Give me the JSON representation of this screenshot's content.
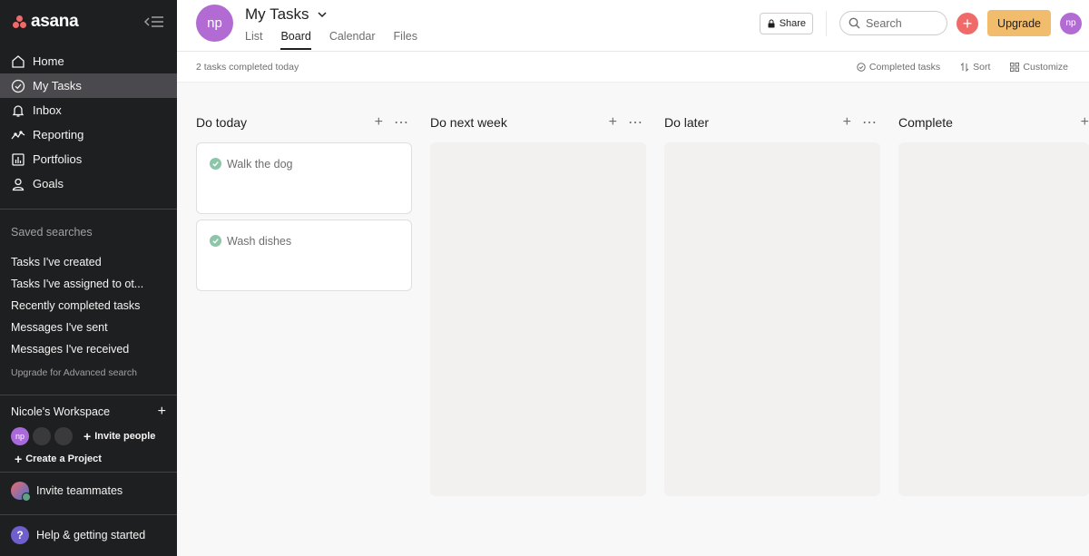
{
  "sidebar": {
    "logo_text": "asana",
    "nav": [
      {
        "label": "Home",
        "icon": "home-icon"
      },
      {
        "label": "My Tasks",
        "icon": "check-circle-icon",
        "active": true
      },
      {
        "label": "Inbox",
        "icon": "bell-icon"
      },
      {
        "label": "Reporting",
        "icon": "chart-line-icon"
      },
      {
        "label": "Portfolios",
        "icon": "bar-chart-icon"
      },
      {
        "label": "Goals",
        "icon": "person-icon"
      }
    ],
    "saved_searches_title": "Saved searches",
    "saved_searches": [
      "Tasks I've created",
      "Tasks I've assigned to ot...",
      "Recently completed tasks",
      "Messages I've sent",
      "Messages I've received"
    ],
    "upgrade_search": "Upgrade for Advanced search",
    "workspace_name": "Nicole's Workspace",
    "workspace_avatar": "np",
    "invite_people": "Invite people",
    "create_project": "Create a Project",
    "invite_teammates": "Invite teammates",
    "help": "Help & getting started"
  },
  "header": {
    "avatar": "np",
    "title": "My Tasks",
    "tabs": [
      "List",
      "Board",
      "Calendar",
      "Files"
    ],
    "active_tab": "Board",
    "share": "Share",
    "search_placeholder": "Search",
    "upgrade": "Upgrade",
    "user_avatar": "np"
  },
  "subbar": {
    "status": "2 tasks completed today",
    "completed_tasks": "Completed tasks",
    "sort": "Sort",
    "customize": "Customize"
  },
  "board": {
    "columns": [
      {
        "title": "Do today",
        "cards": [
          "Walk the dog",
          "Wash dishes"
        ]
      },
      {
        "title": "Do next week",
        "cards": []
      },
      {
        "title": "Do later",
        "cards": []
      },
      {
        "title": "Complete",
        "cards": []
      }
    ]
  },
  "colors": {
    "sidebar_bg": "#1e1f21",
    "accent_red": "#f06a6a",
    "upgrade_yellow": "#f1bd6c",
    "avatar_purple": "#b36bd4",
    "done_green": "#8dc5a8"
  }
}
